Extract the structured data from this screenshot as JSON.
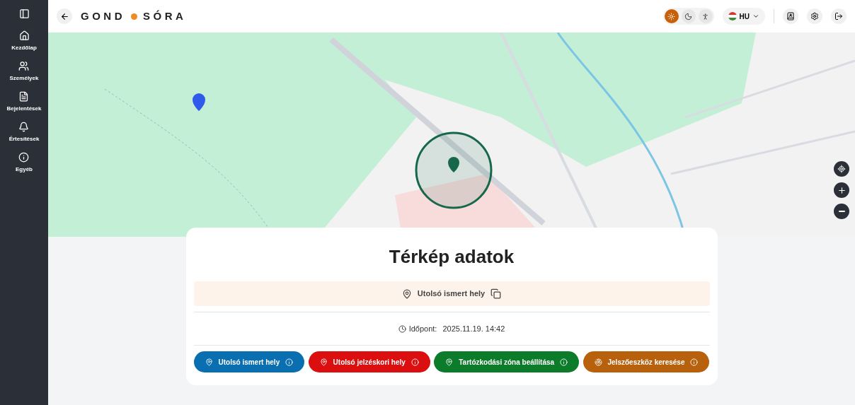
{
  "sidebar": {
    "items": [
      {
        "kind": "home",
        "label": "Kezdőlap"
      },
      {
        "kind": "people",
        "label": "Személyek"
      },
      {
        "kind": "report",
        "label": "Bejelentések"
      },
      {
        "kind": "bell",
        "label": "Értesítések"
      },
      {
        "kind": "info",
        "label": "Egyéb"
      }
    ]
  },
  "header": {
    "logo_left": "GOND",
    "logo_right": "SÓRA",
    "theme_modes": [
      {
        "kind": "light",
        "selected": true
      },
      {
        "kind": "dark",
        "selected": false
      },
      {
        "kind": "contrast",
        "selected": false
      }
    ],
    "language": "HU"
  },
  "card": {
    "title": "Térkép adatok",
    "location_label": "Utolsó ismert hely",
    "time_label": "Időpont:",
    "time_value": "2025.11.19. 14:42",
    "buttons": [
      {
        "kind": "pin",
        "label": "Utolsó ismert hely",
        "color": "#0a6fb0"
      },
      {
        "kind": "pin",
        "label": "Utolsó jelzéskori hely",
        "color": "#db0f0f"
      },
      {
        "kind": "pin",
        "label": "Tartózkodási zóna beállítása",
        "color": "#0d7c2a"
      },
      {
        "kind": "search",
        "label": "Jelszőeszköz keresése",
        "color": "#b8610d"
      }
    ]
  }
}
